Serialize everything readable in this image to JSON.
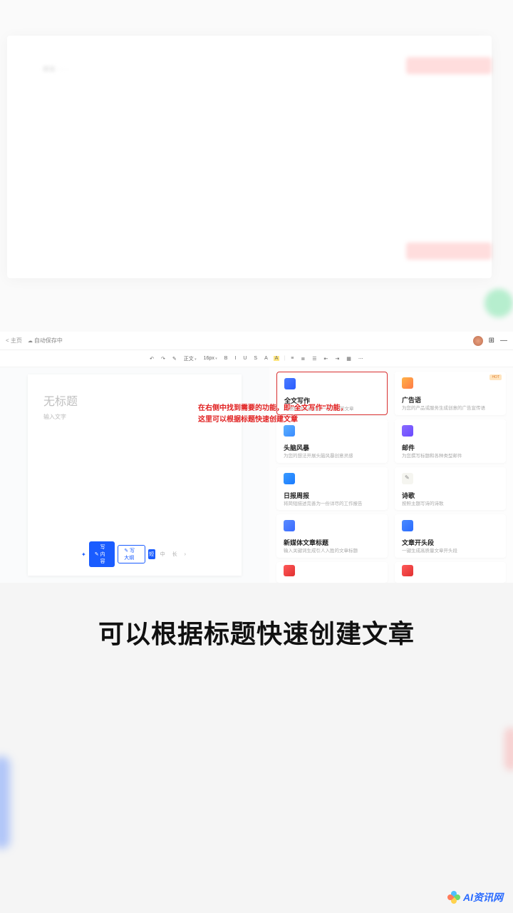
{
  "topbar": {
    "back": "< 主页",
    "cloud_status": "自动保存中"
  },
  "toolbar": {
    "undo": "↶",
    "redo": "↷",
    "format": "格式",
    "t1": "正文",
    "t2": "16px",
    "bold": "B",
    "italic": "I",
    "underline": "U",
    "strike": "S",
    "color_a": "A",
    "highlight": "A",
    "align": "≡",
    "list1": "≣",
    "list2": "☰",
    "indent1": "⇤",
    "indent2": "⇥",
    "more": "⋯"
  },
  "doc": {
    "title_placeholder": "无标题",
    "body_placeholder": "输入文字",
    "btn_content": "写内容",
    "btn_outline": "写大纲",
    "btn_short": "短",
    "btn_mid": "中",
    "btn_long": "长",
    "arrow": "›"
  },
  "cards": [
    {
      "title": "全文写作",
      "desc": "根据标题快速创建一篇完整的文章",
      "icon": "ic-doc",
      "highlight": true
    },
    {
      "title": "广告语",
      "desc": "为您的产品或服务生成创意的广告宣传语",
      "icon": "ic-ad",
      "badge": "HOT"
    },
    {
      "title": "头脑风暴",
      "desc": "为您的想法开展头脑风暴创意灵感",
      "icon": "ic-brain"
    },
    {
      "title": "邮件",
      "desc": "为您撰写标题和各种类型邮件",
      "icon": "ic-mail"
    },
    {
      "title": "日报周报",
      "desc": "将简短描述完善为一份详尽的工作报告",
      "icon": "ic-report"
    },
    {
      "title": "诗歌",
      "desc": "按照主题写诗的诗歌",
      "icon": "ic-poem"
    },
    {
      "title": "新媒体文章标题",
      "desc": "输入关键词生成引人入胜的文章标题",
      "icon": "ic-media"
    },
    {
      "title": "文章开头段",
      "desc": "一键生成高质量文章开头段",
      "icon": "ic-open"
    }
  ],
  "annotation": {
    "line1": "在右侧中找到需要的功能，即\"全文写作\"功能，",
    "line2": "这里可以根据标题快速创建文章"
  },
  "caption": "可以根据标题快速创建文章",
  "watermark": "AI资讯网"
}
